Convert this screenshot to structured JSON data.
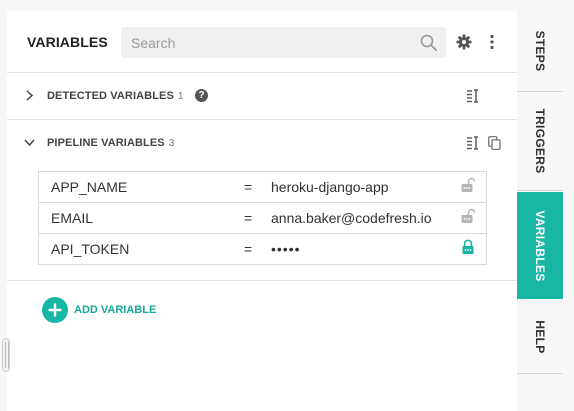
{
  "header": {
    "title": "VARIABLES",
    "search_placeholder": "Search"
  },
  "detected": {
    "title": "DETECTED VARIABLES",
    "count": "1",
    "help": "?"
  },
  "pipeline": {
    "title": "PIPELINE VARIABLES",
    "count": "3",
    "variables": [
      {
        "key": "APP_NAME",
        "eq": "=",
        "value": "heroku-django-app",
        "encrypted": false
      },
      {
        "key": "EMAIL",
        "eq": "=",
        "value": "anna.baker@codefresh.io",
        "encrypted": false
      },
      {
        "key": "API_TOKEN",
        "eq": "=",
        "value": "•••••",
        "encrypted": true
      }
    ]
  },
  "add_variable_label": "ADD VARIABLE",
  "tabs": [
    {
      "label": "STEPS",
      "active": false
    },
    {
      "label": "TRIGGERS",
      "active": false
    },
    {
      "label": "VARIABLES",
      "active": true
    },
    {
      "label": "HELP",
      "active": false
    }
  ],
  "colors": {
    "accent": "#18b7a5",
    "lock_locked": "#18b7a5",
    "lock_unlocked": "#b5b5b5"
  },
  "icons": {
    "search": "search-icon",
    "settings": "gear-icon",
    "more": "kebab-menu-icon",
    "collapsed": "chevron-right-icon",
    "expanded": "chevron-down-icon",
    "bulk_edit": "bulk-edit-icon",
    "copy": "copy-icon",
    "encrypt": "lock-icon",
    "add": "plus-icon"
  }
}
